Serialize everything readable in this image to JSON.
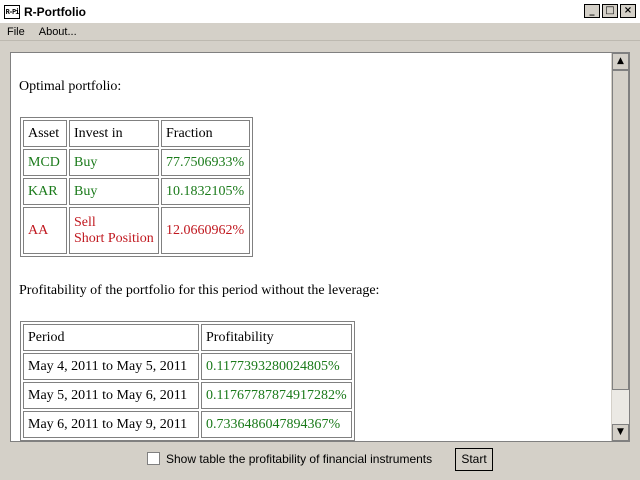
{
  "window": {
    "title": "R-Portfolio",
    "icon_text": "R-Pi"
  },
  "menu": [
    {
      "label": "File"
    },
    {
      "label": "About..."
    }
  ],
  "content": {
    "optimal_heading": "Optimal portfolio:",
    "portfolio_table": {
      "headers": [
        "Asset",
        "Invest in",
        "Fraction"
      ],
      "rows": [
        {
          "asset": "MCD",
          "invest": "Buy",
          "invest2": "",
          "fraction": "77.7506933%",
          "color": "#1a7a1a"
        },
        {
          "asset": "KAR",
          "invest": "Buy",
          "invest2": "",
          "fraction": "10.1832105%",
          "color": "#1a7a1a"
        },
        {
          "asset": "AA",
          "invest": "Sell",
          "invest2": "Short Position",
          "fraction": "12.0660962%",
          "color": "#c0181f"
        }
      ]
    },
    "profit_heading": "Profitability of the portfolio for this period without the leverage:",
    "profit_table": {
      "headers": [
        "Period",
        "Profitability"
      ],
      "rows": [
        {
          "period": "May 4, 2011 to May 5, 2011",
          "profit": "0.1177393280024805%"
        },
        {
          "period": "May 5, 2011 to May 6, 2011",
          "profit": "0.11767787874917282%"
        },
        {
          "period": "May 6, 2011 to May 9, 2011",
          "profit": "0.7336486047894367%"
        }
      ]
    }
  },
  "footer": {
    "checkbox_label": "Show table the profitability of financial instruments",
    "checkbox_checked": false,
    "start_label": "Start"
  },
  "colors": {
    "buy": "#1a7a1a",
    "sell": "#c0181f"
  }
}
